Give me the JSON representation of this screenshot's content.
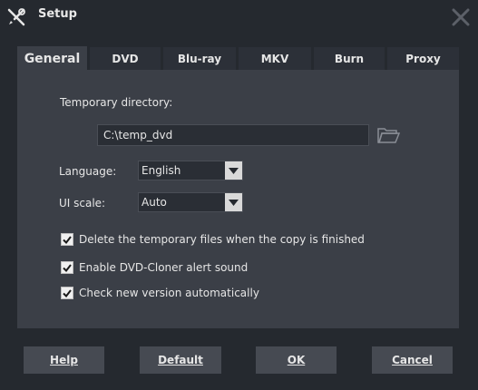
{
  "window": {
    "title": "Setup",
    "title_icon": "tools-icon",
    "close_icon": "close-icon"
  },
  "tabs": [
    {
      "label": "General",
      "active": true
    },
    {
      "label": "DVD",
      "active": false
    },
    {
      "label": "Blu-ray",
      "active": false
    },
    {
      "label": "MKV",
      "active": false
    },
    {
      "label": "Burn",
      "active": false
    },
    {
      "label": "Proxy",
      "active": false
    }
  ],
  "general": {
    "temp_dir_label": "Temporary directory:",
    "temp_dir_value": "C:\\temp_dvd",
    "folder_icon": "folder-icon",
    "language_label": "Language:",
    "language_value": "English",
    "ui_scale_label": "UI scale:",
    "ui_scale_value": "Auto",
    "checkboxes": [
      {
        "label": "Delete the temporary files when the copy is finished",
        "checked": true
      },
      {
        "label": "Enable DVD-Cloner alert sound",
        "checked": true
      },
      {
        "label": "Check new version automatically",
        "checked": true
      }
    ]
  },
  "buttons": {
    "help": "Help",
    "default": "Default",
    "ok": "OK",
    "cancel": "Cancel"
  },
  "colors": {
    "background": "#25292f",
    "panel": "#3b3f47",
    "tab_inactive": "#2c3038",
    "button": "#464a52",
    "text": "#e6e6e6"
  }
}
